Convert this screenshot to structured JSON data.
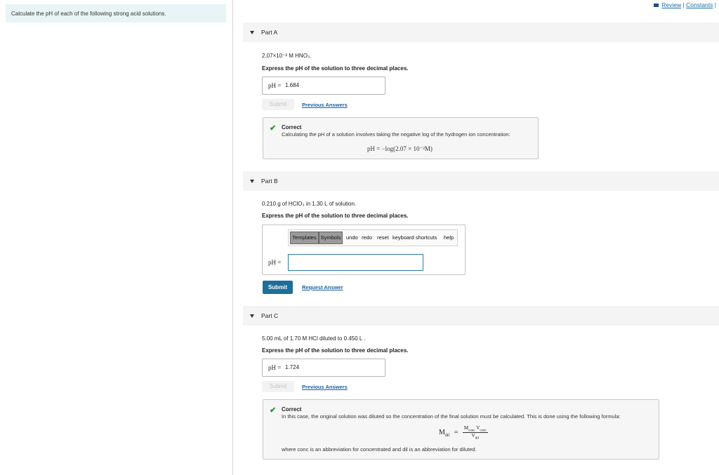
{
  "problem_intro": "Calculate the pH of each of the following strong acid solutions.",
  "topbar": {
    "review": "Review",
    "sep": "|",
    "constants": "Constants",
    "sep2": "|"
  },
  "parts": {
    "a": {
      "title": "Part A",
      "question": "2.07×10⁻² M HNO₃.",
      "instruction": "Express the pH of the solution to three decimal places.",
      "answer_label": "pH =",
      "answer_value": "1.684",
      "submit": "Submit",
      "previous_answers": "Previous Answers",
      "feedback_title": "Correct",
      "feedback_text": "Calculating the pH of a solution involves taking the negative log of the hydrogen ion concentration:",
      "feedback_equation": "pH = −log(2.07 × 10⁻²M)"
    },
    "b": {
      "title": "Part B",
      "question": "0.210 g of HClO₃ in 1.30 L of solution.",
      "instruction": "Express the pH of the solution to three decimal places.",
      "toolbar": {
        "templates": "Templates",
        "symbols": "Symbols",
        "undo": "undo",
        "redo": "redo",
        "reset": "reset",
        "shortcuts": "keyboard shortcuts",
        "help": "help"
      },
      "answer_label": "pH =",
      "answer_value": "",
      "submit": "Submit",
      "request_answer": "Request Answer"
    },
    "c": {
      "title": "Part C",
      "question": "5.00 mL of 1.70 M HCl diluted to 0.450 L .",
      "instruction": "Express the pH of the solution to three decimal places.",
      "answer_label": "pH =",
      "answer_value": "1.724",
      "submit": "Submit",
      "previous_answers": "Previous Answers",
      "feedback_title": "Correct",
      "feedback_text": "In this case, the original solution was diluted so the concentration of the final solution must be calculated. This is done using the following formula:",
      "formula_lhs": "M",
      "formula_lhs_sub": "dil",
      "formula_num": "M",
      "formula_num_sub1": "conc",
      "formula_num2": "V",
      "formula_num_sub2": "conc",
      "formula_den": "V",
      "formula_den_sub": "dil",
      "feedback_note": "where conc is an abbreviation for concentrated and dil is an abbreviation for diluted."
    }
  },
  "colors": {
    "accent": "#1e6f98",
    "correct": "#2e8b2e",
    "link": "#1b5fa0"
  }
}
